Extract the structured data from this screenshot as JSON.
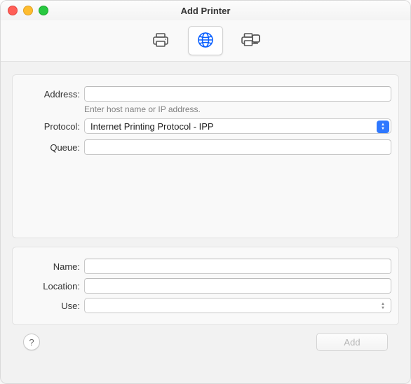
{
  "window": {
    "title": "Add Printer"
  },
  "tabs": {
    "default_tooltip": "Default",
    "ip_tooltip": "IP",
    "windows_tooltip": "Windows"
  },
  "form": {
    "address_label": "Address:",
    "address_value": "",
    "address_hint": "Enter host name or IP address.",
    "protocol_label": "Protocol:",
    "protocol_value": "Internet Printing Protocol - IPP",
    "queue_label": "Queue:",
    "queue_value": "",
    "name_label": "Name:",
    "name_value": "",
    "location_label": "Location:",
    "location_value": "",
    "use_label": "Use:",
    "use_value": ""
  },
  "footer": {
    "add_label": "Add"
  }
}
